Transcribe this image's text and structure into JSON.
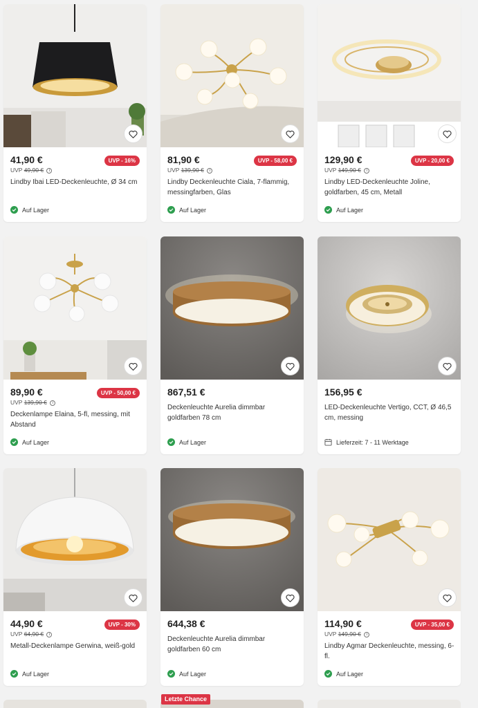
{
  "colors": {
    "badge_red": "#dc3545",
    "in_stock_green": "#2e9e4f",
    "background": "#f2f2f2"
  },
  "products": [
    {
      "price": "41,90 €",
      "uvp_label": "UVP",
      "uvp_old": "49,90 €",
      "uvp_badge": "UVP - 16%",
      "title": "Lindby Ibai LED-Deckenleuchte, Ø 34 cm",
      "availability": "Auf Lager",
      "availability_icon": "check-circle-icon"
    },
    {
      "price": "81,90 €",
      "uvp_label": "UVP",
      "uvp_old": "139,90 €",
      "uvp_badge": "UVP - 58,00 €",
      "title": "Lindby Deckenleuchte Ciala, 7-flammig, messingfarben, Glas",
      "availability": "Auf Lager",
      "availability_icon": "check-circle-icon"
    },
    {
      "price": "129,90 €",
      "uvp_label": "UVP",
      "uvp_old": "149,90 €",
      "uvp_badge": "UVP - 20,00 €",
      "title": "Lindby LED-Deckenleuchte Joline, goldfarben, 45 cm, Metall",
      "availability": "Auf Lager",
      "availability_icon": "check-circle-icon"
    },
    {
      "price": "89,90 €",
      "uvp_label": "UVP",
      "uvp_old": "139,90 €",
      "uvp_badge": "UVP - 50,00 €",
      "title": "Deckenlampe Elaina, 5-fl, messing, mit Abstand",
      "availability": "Auf Lager",
      "availability_icon": "check-circle-icon"
    },
    {
      "price": "867,51 €",
      "title": "Deckenleuchte Aurelia dimmbar goldfarben 78 cm",
      "availability": "Auf Lager",
      "availability_icon": "check-circle-icon"
    },
    {
      "price": "156,95 €",
      "title": "LED-Deckenleuchte Vertigo, CCT, Ø 46,5 cm, messing",
      "availability": "Lieferzeit: 7 - 11 Werktage",
      "availability_icon": "calendar-icon"
    },
    {
      "price": "44,90 €",
      "uvp_label": "UVP",
      "uvp_old": "64,90 €",
      "uvp_badge": "UVP - 30%",
      "title": "Metall-Deckenlampe Gerwina, weiß-gold",
      "availability": "Auf Lager",
      "availability_icon": "check-circle-icon"
    },
    {
      "price": "644,38 €",
      "title": "Deckenleuchte Aurelia dimmbar goldfarben 60 cm",
      "availability": "Auf Lager",
      "availability_icon": "check-circle-icon"
    },
    {
      "price": "114,90 €",
      "uvp_label": "UVP",
      "uvp_old": "149,90 €",
      "uvp_badge": "UVP - 35,00 €",
      "title": "Lindby Agmar Deckenleuchte, messing, 6-fl.",
      "availability": "Auf Lager",
      "availability_icon": "check-circle-icon"
    }
  ],
  "next_row": {
    "badge": "Letzte Chance"
  }
}
